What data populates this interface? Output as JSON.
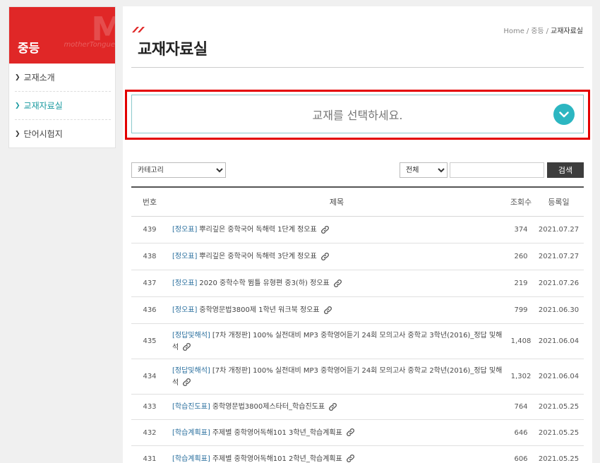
{
  "sidebar": {
    "title": "중등",
    "logo_text": "M",
    "logo_sub": "motherTongue",
    "items": [
      {
        "label": "교재소개",
        "active": false
      },
      {
        "label": "교재자료실",
        "active": true
      },
      {
        "label": "단어시험지",
        "active": false
      }
    ]
  },
  "header": {
    "title": "교재자료실",
    "breadcrumb": [
      "Home",
      "중등",
      "교재자료실"
    ],
    "breadcrumb_sep": "/"
  },
  "selector": {
    "label": "교재를 선택하세요."
  },
  "filters": {
    "category": "카테고리",
    "scope": "전체",
    "search_value": "",
    "search_label": "검색"
  },
  "table": {
    "headers": {
      "num": "번호",
      "title": "제목",
      "views": "조회수",
      "date": "등록일"
    },
    "rows": [
      {
        "num": "439",
        "tag": "[정오표]",
        "title": "뿌리깊은 중학국어 독해력 1단계 정오표",
        "views": "374",
        "date": "2021.07.27"
      },
      {
        "num": "438",
        "tag": "[정오표]",
        "title": "뿌리깊은 중학국어 독해력 3단계 정오표",
        "views": "260",
        "date": "2021.07.27"
      },
      {
        "num": "437",
        "tag": "[정오표]",
        "title": "2020 중학수학 뜀틀 유형편 중3(하) 정오표",
        "views": "219",
        "date": "2021.07.26"
      },
      {
        "num": "436",
        "tag": "[정오표]",
        "title": "중학영문법3800제 1학년 워크북 정오표",
        "views": "799",
        "date": "2021.06.30"
      },
      {
        "num": "435",
        "tag": "[정답및해석]",
        "title": "[7차 개정판] 100% 실전대비 MP3 중학영어듣기 24회 모의고사 중학교 3학년(2016)_정답 및해석",
        "views": "1,408",
        "date": "2021.06.04"
      },
      {
        "num": "434",
        "tag": "[정답및해석]",
        "title": "[7차 개정판] 100% 실전대비 MP3 중학영어듣기 24회 모의고사 중학교 2학년(2016)_정답 및해석",
        "views": "1,302",
        "date": "2021.06.04"
      },
      {
        "num": "433",
        "tag": "[학습진도표]",
        "title": "중학영문법3800제스타터_학습진도표",
        "views": "764",
        "date": "2021.05.25"
      },
      {
        "num": "432",
        "tag": "[학습계획표]",
        "title": "주제별 중학영어독해101 3학년_학습계획표",
        "views": "646",
        "date": "2021.05.25"
      },
      {
        "num": "431",
        "tag": "[학습계획표]",
        "title": "주제별 중학영어독해101 2학년_학습계획표",
        "views": "606",
        "date": "2021.05.25"
      }
    ]
  },
  "colors": {
    "brand_red": "#e02727",
    "accent_teal": "#2cb6c1",
    "highlight_red": "#e30000",
    "tag_blue": "#2a6f9e"
  }
}
